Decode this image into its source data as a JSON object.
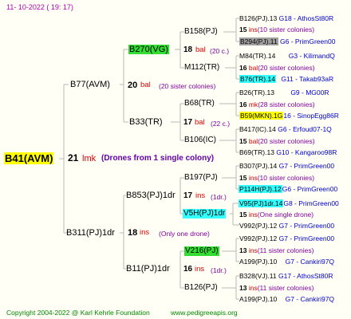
{
  "header": {
    "date": "11- 10-2022 ( 19: 17)"
  },
  "footer": {
    "copyright": "Copyright 2004-2022 @ Karl Kehrle Foundation",
    "site": "www.pedigreeapis.org"
  },
  "colors": {
    "line": "#b8b8b8",
    "red": "#dd0000",
    "blue": "#0000cc",
    "purple": "#8000a0",
    "yellow": "#ffff00",
    "green": "#33dd33",
    "cyan": "#33ffff",
    "gray": "#a0a0a0"
  },
  "root": {
    "name": "B41(AVM)",
    "num": "21",
    "code": "lmk",
    "text": "(Drones from 1 single colony)"
  },
  "g1": [
    {
      "name": "B77(AVM)",
      "num": "20",
      "code": "bal",
      "text": "(20 sister colonies)"
    },
    {
      "name": "B311(PJ)1dr",
      "num": "18",
      "code": "ins",
      "text": "(Only one drone)"
    }
  ],
  "g2": [
    {
      "name": "B270(VG)",
      "num": "18",
      "code": "bal",
      "text": "(20 c.)"
    },
    {
      "name": "B33(TR)",
      "num": "17",
      "code": "bal",
      "text": "(22 c.)"
    },
    {
      "name": "B853(PJ)1dr",
      "num": "17",
      "code": "ins",
      "text": "(1dr.)"
    },
    {
      "name": "B11(PJ)1dr",
      "num": "16",
      "code": "ins",
      "text": "(1dr.)"
    }
  ],
  "g3": [
    "B158(PJ)",
    "M112(TR)",
    "B68(TR)",
    "B106(IC)",
    "B197(PJ)",
    "V5H(PJ)1dr",
    "V216(PJ)",
    "B126(PJ)"
  ],
  "g4": [
    {
      "a": "B126(PJ).13",
      "b": "G18 - AthosSt80R"
    },
    {
      "num": "15",
      "code": "ins",
      "text": "(10 sister colonies)"
    },
    {
      "a": "B294(PJ).11",
      "b": "G6 - PrimGreen00"
    },
    {
      "a": "M84(TR).14",
      "b": "G3 - KilimandQ"
    },
    {
      "num": "16",
      "code": "bal",
      "text": "(20 sister colonies)"
    },
    {
      "a": "B76(TR).14",
      "b": "G11 - Takab93aR"
    },
    {
      "a": "B26(TR).13",
      "b": "G9 - MG00R"
    },
    {
      "num": "16",
      "code": "mk",
      "text": "(28 sister colonies)"
    },
    {
      "a": "B59(MKN).1G",
      "b": "16 - SinopEgg86R"
    },
    {
      "a": "B417(IC).14",
      "b": "G6 - Erfoud07-1Q"
    },
    {
      "num": "15",
      "code": "bal",
      "text": "(20 sister colonies)"
    },
    {
      "a": "B69(TR).13",
      "b": "G10 - Kangaroo98R"
    },
    {
      "a": "B307(PJ).14",
      "b": "G7 - PrimGreen00"
    },
    {
      "num": "15",
      "code": "ins",
      "text": "(10 sister colonies)"
    },
    {
      "a": "P114H(PJ).12",
      "b": "G6 - PrimGreen00"
    },
    {
      "a": "V95(PJ)1dr.14",
      "b": "G8 - PrimGreen00"
    },
    {
      "num": "15",
      "code": "ins",
      "text": "(One single drone)"
    },
    {
      "a": "V992(PJ).12",
      "b": "G7 - PrimGreen00"
    },
    {
      "a": "V992(PJ).12",
      "b": "G7 - PrimGreen00"
    },
    {
      "num": "13",
      "code": "ins",
      "text": "(11 sister colonies)"
    },
    {
      "a": "A199(PJ).10",
      "b": "G7 - Cankiri97Q"
    },
    {
      "a": "B328(VJ).11",
      "b": "G17 - AthosSt80R"
    },
    {
      "num": "13",
      "code": "ins",
      "text": "(11 sister colonies)"
    },
    {
      "a": "A199(PJ).10",
      "b": "G7 - Cankiri97Q"
    }
  ]
}
